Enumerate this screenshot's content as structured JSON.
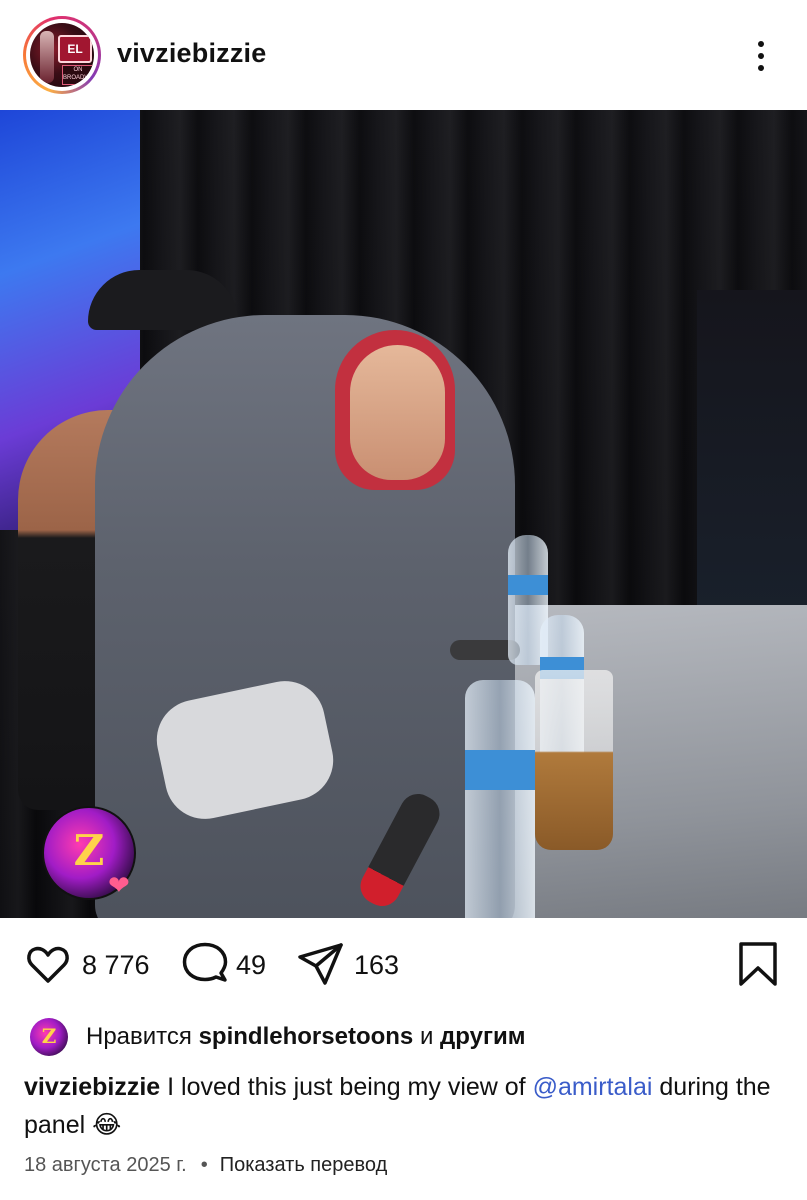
{
  "header": {
    "username": "vivziebizzie",
    "avatar_sign_text": "EL",
    "avatar_ticket_text": "ON BROADWAY"
  },
  "photo": {
    "overlay_avatar_letter": "Z",
    "heart_sticker": "❤"
  },
  "actions": {
    "likes_count": "8 776",
    "comments_count": "49",
    "shares_count": "163"
  },
  "likes_line": {
    "avatar_letter": "Z",
    "prefix": "Нравится",
    "user": "spindlehorsetoons",
    "middle": "и",
    "suffix": "другим"
  },
  "caption": {
    "user": "vivziebizzie",
    "text_before": "I loved this just being my view of",
    "mention": "@amirtalai",
    "text_after": "during the panel 😂"
  },
  "footer": {
    "date": "18 августа 2025 г.",
    "separator": "•",
    "translate": "Показать перевод"
  }
}
